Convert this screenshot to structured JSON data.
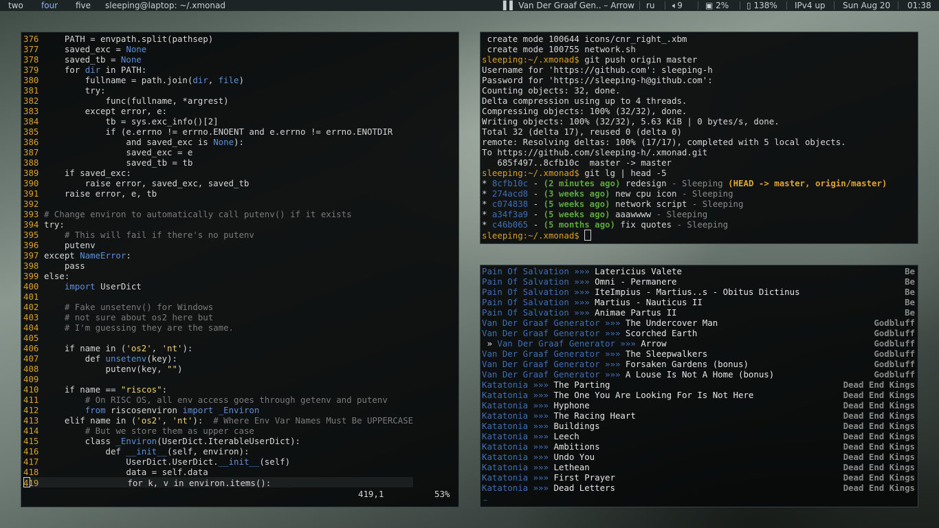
{
  "topbar": {
    "workspaces": [
      "two",
      "four",
      "five"
    ],
    "active_workspace": "four",
    "window_title": "sleeping@laptop: ~/.xmonad",
    "now_playing": "Van Der Graaf Gen.. – Arrow",
    "layout": "ru",
    "volume": "9",
    "cpu": "2%",
    "battery": "138%",
    "network": "IPv4 up",
    "date": "Sun Aug 20",
    "time": "01:38"
  },
  "vim": {
    "lines": [
      {
        "n": "376",
        "t": "    PATH = envpath.split(pathsep)"
      },
      {
        "n": "377",
        "t": "    saved_exc = None"
      },
      {
        "n": "378",
        "t": "    saved_tb = None"
      },
      {
        "n": "379",
        "t": "    for dir in PATH:"
      },
      {
        "n": "380",
        "t": "        fullname = path.join(dir, file)"
      },
      {
        "n": "381",
        "t": "        try:"
      },
      {
        "n": "382",
        "t": "            func(fullname, *argrest)"
      },
      {
        "n": "383",
        "t": "        except error, e:"
      },
      {
        "n": "384",
        "t": "            tb = sys.exc_info()[2]"
      },
      {
        "n": "385",
        "t": "            if (e.errno != errno.ENOENT and e.errno != errno.ENOTDIR"
      },
      {
        "n": "386",
        "t": "                and saved_exc is None):"
      },
      {
        "n": "387",
        "t": "                saved_exc = e"
      },
      {
        "n": "388",
        "t": "                saved_tb = tb"
      },
      {
        "n": "389",
        "t": "    if saved_exc:"
      },
      {
        "n": "390",
        "t": "        raise error, saved_exc, saved_tb"
      },
      {
        "n": "391",
        "t": "    raise error, e, tb"
      },
      {
        "n": "392",
        "t": ""
      },
      {
        "n": "393",
        "t": "# Change environ to automatically call putenv() if it exists"
      },
      {
        "n": "394",
        "t": "try:"
      },
      {
        "n": "395",
        "t": "    # This will fail if there's no putenv"
      },
      {
        "n": "396",
        "t": "    putenv"
      },
      {
        "n": "397",
        "t": "except NameError:"
      },
      {
        "n": "398",
        "t": "    pass"
      },
      {
        "n": "399",
        "t": "else:"
      },
      {
        "n": "400",
        "t": "    import UserDict"
      },
      {
        "n": "401",
        "t": ""
      },
      {
        "n": "402",
        "t": "    # Fake unsetenv() for Windows"
      },
      {
        "n": "403",
        "t": "    # not sure about os2 here but"
      },
      {
        "n": "404",
        "t": "    # I'm guessing they are the same."
      },
      {
        "n": "405",
        "t": ""
      },
      {
        "n": "406",
        "t": "    if name in ('os2', 'nt'):"
      },
      {
        "n": "407",
        "t": "        def unsetenv(key):"
      },
      {
        "n": "408",
        "t": "            putenv(key, \"\")"
      },
      {
        "n": "409",
        "t": ""
      },
      {
        "n": "410",
        "t": "    if name == \"riscos\":"
      },
      {
        "n": "411",
        "t": "        # On RISC OS, all env access goes through getenv and putenv"
      },
      {
        "n": "412",
        "t": "        from riscosenviron import _Environ"
      },
      {
        "n": "413",
        "t": "    elif name in ('os2', 'nt'):  # Where Env Var Names Must Be UPPERCASE"
      },
      {
        "n": "414",
        "t": "        # But we store them as upper case"
      },
      {
        "n": "415",
        "t": "        class _Environ(UserDict.IterableUserDict):"
      },
      {
        "n": "416",
        "t": "            def __init__(self, environ):"
      },
      {
        "n": "417",
        "t": "                UserDict.UserDict.__init__(self)"
      },
      {
        "n": "418",
        "t": "                data = self.data"
      },
      {
        "n": "419",
        "t": "                for k, v in environ.items():"
      }
    ],
    "position": "419,1",
    "percent": "53%"
  },
  "terminal": {
    "lines": [
      " create mode 100644 icons/cnr_right_.xbm",
      " create mode 100755 network.sh",
      "sleeping:~/.xmonad$ git push origin master",
      "Username for 'https://github.com': sleeping-h",
      "Password for 'https://sleeping-h@github.com':",
      "Counting objects: 32, done.",
      "Delta compression using up to 4 threads.",
      "Compressing objects: 100% (32/32), done.",
      "Writing objects: 100% (32/32), 5.63 KiB | 0 bytes/s, done.",
      "Total 32 (delta 17), reused 0 (delta 0)",
      "remote: Resolving deltas: 100% (17/17), completed with 5 local objects.",
      "To https://github.com/sleeping-h/.xmonad.git",
      "   685f497..8cfb10c  master -> master",
      "sleeping:~/.xmonad$ git lg | head -5"
    ],
    "log": [
      {
        "hash": "8cfb10c",
        "age": "(2 minutes ago)",
        "msg": "redesign",
        "author": "Sleeping",
        "refs": "(HEAD -> master, origin/master)"
      },
      {
        "hash": "274acd8",
        "age": "(3 weeks ago)",
        "msg": "new cpu icon",
        "author": "Sleeping",
        "refs": ""
      },
      {
        "hash": "c074838",
        "age": "(5 weeks ago)",
        "msg": "network script",
        "author": "Sleeping",
        "refs": ""
      },
      {
        "hash": "a34f3a9",
        "age": "(5 weeks ago)",
        "msg": "aaawwww",
        "author": "Sleeping",
        "refs": ""
      },
      {
        "hash": "c46b065",
        "age": "(5 months ago)",
        "msg": "fix quotes",
        "author": "Sleeping",
        "refs": ""
      }
    ],
    "final_prompt": "sleeping:~/.xmonad$ "
  },
  "playlist": {
    "arrow": "»»»",
    "current_marker": "»",
    "footer": "~",
    "tracks": [
      {
        "artist": "Pain Of Salvation",
        "title": "Latericius Valete",
        "album": "Be",
        "current": false
      },
      {
        "artist": "Pain Of Salvation",
        "title": "Omni - Permanere",
        "album": "Be",
        "current": false
      },
      {
        "artist": "Pain Of Salvation",
        "title": "IteImpius - Martius..s - Obitus Dictinus",
        "album": "Be",
        "current": false
      },
      {
        "artist": "Pain Of Salvation",
        "title": "Martius - Nauticus II",
        "album": "Be",
        "current": false
      },
      {
        "artist": "Pain Of Salvation",
        "title": "Animae Partus II",
        "album": "Be",
        "current": false
      },
      {
        "artist": "Van Der Graaf Generator",
        "title": "The Undercover Man",
        "album": "Godbluff",
        "current": false
      },
      {
        "artist": "Van Der Graaf Generator",
        "title": "Scorched Earth",
        "album": "Godbluff",
        "current": false
      },
      {
        "artist": "Van Der Graaf Generator",
        "title": "Arrow",
        "album": "Godbluff",
        "current": true
      },
      {
        "artist": "Van Der Graaf Generator",
        "title": "The Sleepwalkers",
        "album": "Godbluff",
        "current": false
      },
      {
        "artist": "Van Der Graaf Generator",
        "title": "Forsaken Gardens (bonus)",
        "album": "Godbluff",
        "current": false
      },
      {
        "artist": "Van Der Graaf Generator",
        "title": "A Louse Is Not A Home (bonus)",
        "album": "Godbluff",
        "current": false
      },
      {
        "artist": "Katatonia",
        "title": "The Parting",
        "album": "Dead End Kings",
        "current": false
      },
      {
        "artist": "Katatonia",
        "title": "The One You Are Looking For Is Not Here",
        "album": "Dead End Kings",
        "current": false
      },
      {
        "artist": "Katatonia",
        "title": "Hyphone",
        "album": "Dead End Kings",
        "current": false
      },
      {
        "artist": "Katatonia",
        "title": "The Racing Heart",
        "album": "Dead End Kings",
        "current": false
      },
      {
        "artist": "Katatonia",
        "title": "Buildings",
        "album": "Dead End Kings",
        "current": false
      },
      {
        "artist": "Katatonia",
        "title": "Leech",
        "album": "Dead End Kings",
        "current": false
      },
      {
        "artist": "Katatonia",
        "title": "Ambitions",
        "album": "Dead End Kings",
        "current": false
      },
      {
        "artist": "Katatonia",
        "title": "Undo You",
        "album": "Dead End Kings",
        "current": false
      },
      {
        "artist": "Katatonia",
        "title": "Lethean",
        "album": "Dead End Kings",
        "current": false
      },
      {
        "artist": "Katatonia",
        "title": "First Prayer",
        "album": "Dead End Kings",
        "current": false
      },
      {
        "artist": "Katatonia",
        "title": "Dead Letters",
        "album": "Dead End Kings",
        "current": false
      }
    ]
  },
  "colors": {
    "accent_blue": "#3f6fb6",
    "prompt_yellow": "#d9a227",
    "green": "#5aa83a"
  },
  "icons": {
    "pause": "pause-icon",
    "volume": "speaker-icon",
    "cpu": "cpu-icon",
    "battery": "battery-icon"
  }
}
